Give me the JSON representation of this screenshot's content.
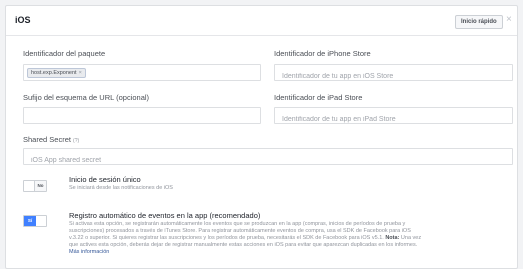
{
  "header": {
    "title": "iOS",
    "quick_start_label": "Inicio rápido",
    "close_glyph": "×"
  },
  "fields": {
    "bundle_id": {
      "label": "Identificador del paquete",
      "token": "host.exp.Exponent",
      "token_remove": "×"
    },
    "iphone_store_id": {
      "label": "Identificador de iPhone Store",
      "placeholder": "Identificador de tu app en iOS Store"
    },
    "url_scheme_suffix": {
      "label": "Sufijo del esquema de URL (opcional)",
      "placeholder": ""
    },
    "ipad_store_id": {
      "label": "Identificador de iPad Store",
      "placeholder": "Identificador de tu app en iPad Store"
    },
    "shared_secret": {
      "label": "Shared Secret",
      "help": "(?)",
      "placeholder": "iOS App shared secret"
    }
  },
  "single_sign_on": {
    "toggle_label": "No",
    "state": "off",
    "title": "Inicio de sesión único",
    "description": "Se iniciará desde las notificaciones de iOS"
  },
  "auto_event_logging": {
    "toggle_label": "Sí",
    "state": "on",
    "title": "Registro automático de eventos en la app (recomendado)",
    "description_1": "Si activas esta opción, se registrarán automáticamente los eventos que se produzcan en la app (compras, inicios de períodos de prueba y suscripciones) procesados a través de iTunes Store. Para registrar automáticamente eventos de compra, usa el SDK de Facebook para iOS v.3.22 o superior. Si quieres registrar las suscripciones y los períodos de prueba, necesitarás el SDK de Facebook para iOS v5.1.",
    "note_label": "Nota:",
    "description_2": "Una vez que actives esta opción, deberás dejar de registrar manualmente estas acciones en iOS para evitar que aparezcan duplicadas en los informes.",
    "more_info": "Más información"
  },
  "colors": {
    "accent": "#4080ff",
    "link": "#365899",
    "background": "#f2f3f5"
  }
}
